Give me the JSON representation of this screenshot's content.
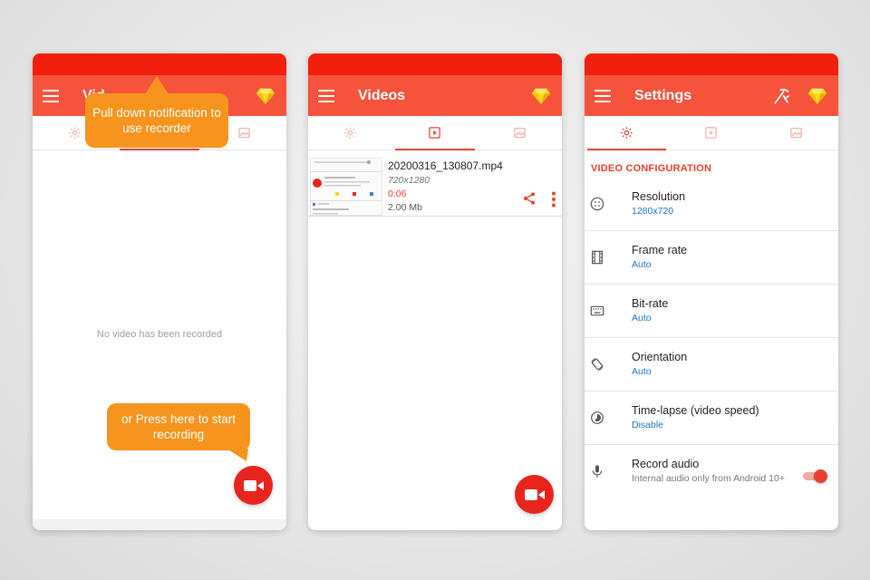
{
  "colors": {
    "statusbar": "#f11f0b",
    "appbar": "#f5533c",
    "accent": "#e8412c",
    "bubble": "#f7941d",
    "fab": "#e8251c",
    "link": "#1a73c9"
  },
  "screen1": {
    "title": "Vid",
    "bubble_top": "Pull down notification to use recorder",
    "empty_message": "No video has been recorded",
    "bubble_bottom": "or Press here to start recording"
  },
  "screen2": {
    "title": "Videos",
    "video": {
      "filename": "20200316_130807.mp4",
      "resolution": "720x1280",
      "duration": "0:06",
      "size": "2.00 Mb"
    }
  },
  "screen3": {
    "title": "Settings",
    "section": "VIDEO CONFIGURATION",
    "items": [
      {
        "title": "Resolution",
        "value": "1280x720",
        "icon": "resolution-icon"
      },
      {
        "title": "Frame rate",
        "value": "Auto",
        "icon": "film-icon"
      },
      {
        "title": "Bit-rate",
        "value": "Auto",
        "icon": "keyboard-icon"
      },
      {
        "title": "Orientation",
        "value": "Auto",
        "icon": "rotate-icon"
      },
      {
        "title": "Time-lapse (video speed)",
        "value": "Disable",
        "icon": "timelapse-icon"
      },
      {
        "title": "Record audio",
        "subtitle": "Internal audio only from Android 10+",
        "icon": "mic-icon",
        "toggle": true
      }
    ]
  }
}
